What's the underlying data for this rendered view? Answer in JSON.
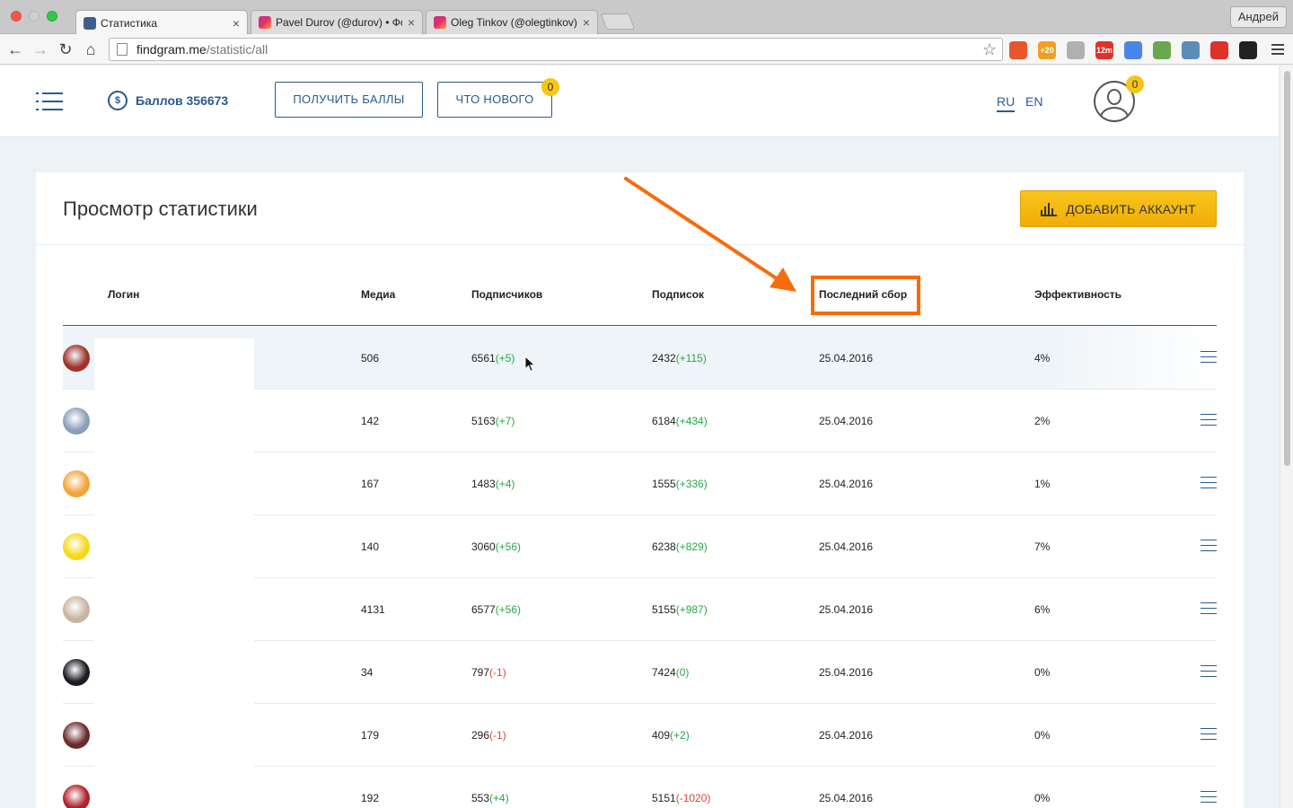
{
  "browser": {
    "tabs": [
      {
        "title": "Статистика",
        "favicon": "findgram-favicon",
        "active": true
      },
      {
        "title": "Pavel Durov (@durov) • Фо",
        "favicon": "instagram-favicon",
        "active": false
      },
      {
        "title": "Oleg Tinkov (@olegtinkov)",
        "favicon": "instagram-favicon",
        "active": false
      }
    ],
    "profile_name": "Андрей",
    "url_host": "findgram.me",
    "url_path": "/statistic/all",
    "extensions": [
      {
        "name": "ext-1-icon",
        "color": "#e8572a",
        "text": ""
      },
      {
        "name": "ext-2-icon",
        "color": "#f0a020",
        "text": "+20"
      },
      {
        "name": "ext-3-icon",
        "color": "#b0b0b0",
        "text": ""
      },
      {
        "name": "ext-4-icon",
        "color": "#e0302a",
        "text": "12m"
      },
      {
        "name": "ext-5-icon",
        "color": "#4a86e8",
        "text": ""
      },
      {
        "name": "ext-6-icon",
        "color": "#6aa84f",
        "text": ""
      },
      {
        "name": "ext-7-icon",
        "color": "#5b8db8",
        "text": ""
      },
      {
        "name": "ext-8-icon",
        "color": "#e0302a",
        "text": ""
      },
      {
        "name": "ext-9-icon",
        "color": "#222222",
        "text": ""
      }
    ]
  },
  "header": {
    "balance_label": "Баллов 356673",
    "coin_symbol": "$",
    "get_points_label": "ПОЛУЧИТЬ БАЛЛЫ",
    "whats_new_label": "ЧТО НОВОГО",
    "whats_new_badge": "0",
    "lang_ru": "RU",
    "lang_en": "EN",
    "avatar_badge": "0"
  },
  "card": {
    "title": "Просмотр статистики",
    "add_button_label": "ДОБАВИТЬ АККАУНТ"
  },
  "table": {
    "columns": {
      "login": "Логин",
      "media": "Медиа",
      "followers": "Подписчиков",
      "following": "Подписок",
      "last_collect": "Последний сбор",
      "efficiency": "Эффективность"
    },
    "rows": [
      {
        "media": "506",
        "followers": "6561",
        "followers_delta": "(+5)",
        "following": "2432",
        "following_delta": "(+115)",
        "last": "25.04.2016",
        "eff": "4%",
        "avatar_color": "#a0322a"
      },
      {
        "media": "142",
        "followers": "5163",
        "followers_delta": "(+7)",
        "following": "6184",
        "following_delta": "(+434)",
        "last": "25.04.2016",
        "eff": "2%",
        "avatar_color": "#8a9fb8"
      },
      {
        "media": "167",
        "followers": "1483",
        "followers_delta": "(+4)",
        "following": "1555",
        "following_delta": "(+336)",
        "last": "25.04.2016",
        "eff": "1%",
        "avatar_color": "#f2a43a"
      },
      {
        "media": "140",
        "followers": "3060",
        "followers_delta": "(+56)",
        "following": "6238",
        "following_delta": "(+829)",
        "last": "25.04.2016",
        "eff": "7%",
        "avatar_color": "#f7d81a"
      },
      {
        "media": "4131",
        "followers": "6577",
        "followers_delta": "(+56)",
        "following": "5155",
        "following_delta": "(+987)",
        "last": "25.04.2016",
        "eff": "6%",
        "avatar_color": "#c9b4a0"
      },
      {
        "media": "34",
        "followers": "797",
        "followers_delta": "(-1)",
        "following": "7424",
        "following_delta": "(0)",
        "last": "25.04.2016",
        "eff": "0%",
        "avatar_color": "#1c1c22"
      },
      {
        "media": "179",
        "followers": "296",
        "followers_delta": "(-1)",
        "following": "409",
        "following_delta": "(+2)",
        "last": "25.04.2016",
        "eff": "0%",
        "avatar_color": "#6a2a2a"
      },
      {
        "media": "192",
        "followers": "553",
        "followers_delta": "(+4)",
        "following": "5151",
        "following_delta": "(-1020)",
        "last": "25.04.2016",
        "eff": "0%",
        "avatar_color": "#b0202a"
      }
    ]
  },
  "colors": {
    "accent": "#2a5b8d",
    "positive": "#28a745",
    "negative": "#d9483b",
    "annotation": "#f76b0d",
    "cta": "#f5b80f"
  }
}
